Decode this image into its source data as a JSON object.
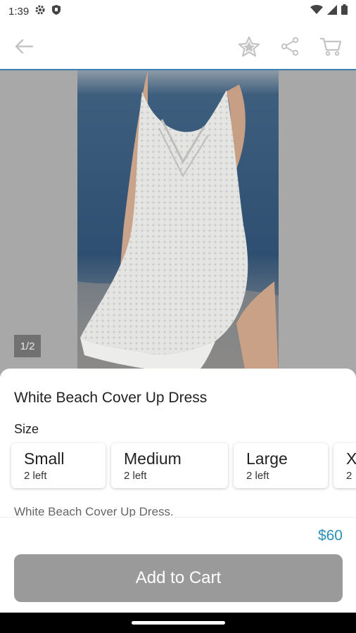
{
  "status_bar": {
    "time": "1:39",
    "icons": [
      "gear-icon",
      "shield-icon",
      "wifi-icon",
      "cellular-icon",
      "battery-icon"
    ]
  },
  "app_bar": {
    "icons": [
      "back-arrow-icon",
      "star-icon",
      "share-icon",
      "cart-icon"
    ]
  },
  "gallery": {
    "counter": "1/2"
  },
  "product": {
    "title": "White Beach Cover Up Dress",
    "size_label": "Size",
    "sizes": [
      {
        "name": "Small",
        "stock": "2 left"
      },
      {
        "name": "Medium",
        "stock": "2 left"
      },
      {
        "name": "Large",
        "stock": "2 left"
      },
      {
        "name": "X",
        "stock": "2"
      }
    ],
    "description": "White Beach Cover Up Dress.",
    "price": "$60"
  },
  "actions": {
    "add_to_cart": "Add to Cart"
  },
  "colors": {
    "accent": "#2a8fb8",
    "divider": "#3a7fb0",
    "button_disabled": "#9a9a9a",
    "image_overlay": "#a8a8a8"
  }
}
